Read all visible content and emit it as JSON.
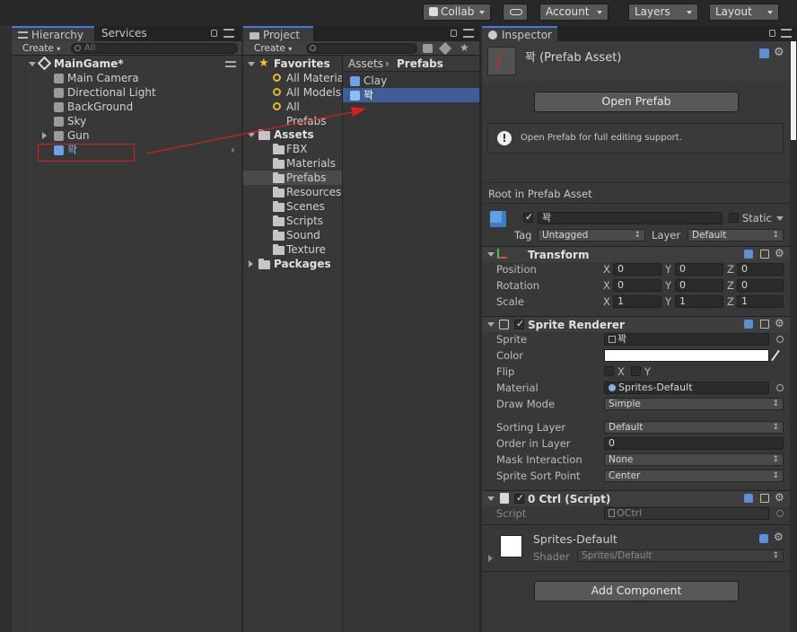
{
  "toolbar": {
    "collab": "Collab",
    "account": "Account",
    "layers": "Layers",
    "layout": "Layout"
  },
  "hierarchy": {
    "tab": "Hierarchy",
    "tab2": "Services",
    "create": "Create",
    "search_placeholder": "All",
    "scene": "MainGame*",
    "items": [
      "Main Camera",
      "Directional Light",
      "BackGround",
      "Sky",
      "Gun",
      "꽉"
    ]
  },
  "project": {
    "tab": "Project",
    "create": "Create",
    "favorites": "Favorites",
    "fav_items": [
      "All Material",
      "All Models",
      "All Prefabs"
    ],
    "assets": "Assets",
    "folders": [
      "FBX",
      "Materials",
      "Prefabs",
      "Resources",
      "Scenes",
      "Scripts",
      "Sound",
      "Texture"
    ],
    "packages": "Packages",
    "breadcrumb_root": "Assets",
    "breadcrumb_current": "Prefabs",
    "files": [
      "Clay",
      "꽉"
    ]
  },
  "inspector": {
    "tab": "Inspector",
    "asset_title": "꽉 (Prefab Asset)",
    "open_prefab": "Open Prefab",
    "info_text": "Open Prefab for full editing support.",
    "root_label": "Root in Prefab Asset",
    "object_name": "꽉",
    "static_label": "Static",
    "tag_label": "Tag",
    "tag_value": "Untagged",
    "layer_label": "Layer",
    "layer_value": "Default",
    "transform": {
      "title": "Transform",
      "rows": [
        {
          "label": "Position",
          "x": "0",
          "y": "0",
          "z": "0"
        },
        {
          "label": "Rotation",
          "x": "0",
          "y": "0",
          "z": "0"
        },
        {
          "label": "Scale",
          "x": "1",
          "y": "1",
          "z": "1"
        }
      ],
      "axis_x": "X",
      "axis_y": "Y",
      "axis_z": "Z"
    },
    "sprite_renderer": {
      "title": "Sprite Renderer",
      "sprite_label": "Sprite",
      "sprite_value": "꽉",
      "color_label": "Color",
      "flip_label": "Flip",
      "flip_x": "X",
      "flip_y": "Y",
      "material_label": "Material",
      "material_value": "Sprites-Default",
      "draw_mode_label": "Draw Mode",
      "draw_mode_value": "Simple",
      "sorting_layer_label": "Sorting Layer",
      "sorting_layer_value": "Default",
      "order_label": "Order in Layer",
      "order_value": "0",
      "mask_label": "Mask Interaction",
      "mask_value": "None",
      "sort_point_label": "Sprite Sort Point",
      "sort_point_value": "Center"
    },
    "script_comp": {
      "title": "0 Ctrl (Script)",
      "script_label": "Script",
      "script_value": "OCtrl"
    },
    "material": {
      "name": "Sprites-Default",
      "shader_label": "Shader",
      "shader_value": "Sprites/Default"
    },
    "add_component": "Add Component"
  },
  "colors": {
    "selection": "#3e5f96",
    "annotation": "#d42020",
    "tab_accent": "#3d7bdc"
  }
}
